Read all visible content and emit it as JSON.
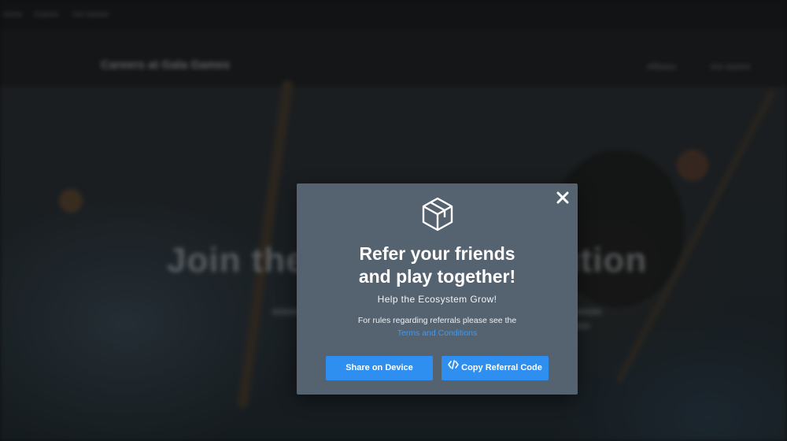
{
  "background": {
    "topbar_items": [
      "Home",
      "Explore",
      "Get Started"
    ],
    "brand": "Careers at Gala Games",
    "nav_links": [
      "Affiliates",
      "Get started"
    ],
    "headline": "Join the Gaming Revolution"
  },
  "modal": {
    "logo_icon": "gala-cube-logo-icon",
    "close_icon": "close-icon",
    "title_line1": "Refer your friends",
    "title_line2": "and play together!",
    "subtitle": "Help the Ecosystem Grow!",
    "rules_text": "For rules regarding referrals please see the",
    "terms_link": "Terms and Conditions",
    "share_button": "Share on Device",
    "copy_button": "Copy Referral Code",
    "copy_icon": "code-icon"
  },
  "colors": {
    "modal_bg": "#556270",
    "button_bg": "#2f8ff0",
    "link": "#3b9bf0",
    "overlay": "#121314"
  }
}
